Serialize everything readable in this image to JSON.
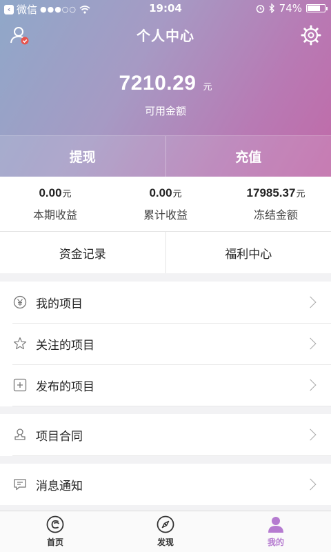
{
  "status_bar": {
    "carrier": "微信",
    "signal": "●●●○○",
    "time": "19:04",
    "battery": "74%",
    "battery_level": 0.74
  },
  "header": {
    "title": "个人中心",
    "user_icon": "user-check-icon",
    "settings_icon": "gear-icon"
  },
  "balance": {
    "amount": "7210.29",
    "unit": "元",
    "label": "可用金额"
  },
  "actions": {
    "withdraw": "提现",
    "recharge": "充值"
  },
  "stats": [
    {
      "value": "0.00",
      "unit": "元",
      "label": "本期收益"
    },
    {
      "value": "0.00",
      "unit": "元",
      "label": "累计收益"
    },
    {
      "value": "17985.37",
      "unit": "元",
      "label": "冻结金额"
    }
  ],
  "shortcuts": {
    "fund_records": "资金记录",
    "welfare_center": "福利中心"
  },
  "menu_group_1": [
    {
      "label": "我的项目",
      "icon": "yen-circle-icon"
    },
    {
      "label": "关注的项目",
      "icon": "star-icon"
    },
    {
      "label": "发布的项目",
      "icon": "plus-square-icon"
    }
  ],
  "menu_group_2": [
    {
      "label": "项目合同",
      "icon": "stamp-icon"
    }
  ],
  "menu_group_3": [
    {
      "label": "消息通知",
      "icon": "message-icon"
    }
  ],
  "tabbar": [
    {
      "label": "首页",
      "icon": "home-logo-icon",
      "active": false
    },
    {
      "label": "发现",
      "icon": "compass-icon",
      "active": false
    },
    {
      "label": "我的",
      "icon": "person-icon",
      "active": true
    }
  ],
  "colors": {
    "accent": "#b57bd0",
    "hero_start": "#8fa8c9",
    "hero_end": "#c06aa8"
  }
}
